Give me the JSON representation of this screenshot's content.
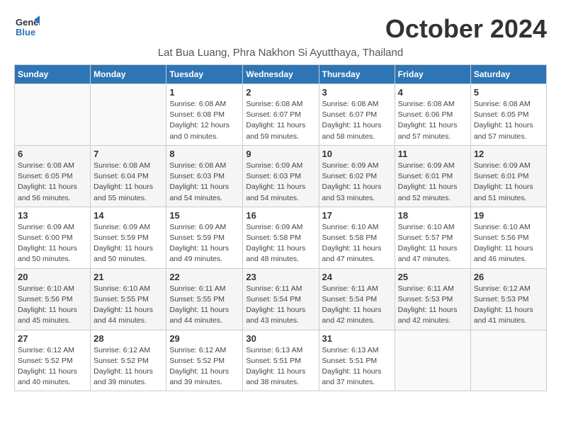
{
  "logo": {
    "line1": "General",
    "line2": "Blue"
  },
  "title": "October 2024",
  "subtitle": "Lat Bua Luang, Phra Nakhon Si Ayutthaya, Thailand",
  "header": {
    "days": [
      "Sunday",
      "Monday",
      "Tuesday",
      "Wednesday",
      "Thursday",
      "Friday",
      "Saturday"
    ]
  },
  "weeks": [
    [
      {
        "day": "",
        "info": ""
      },
      {
        "day": "",
        "info": ""
      },
      {
        "day": "1",
        "info": "Sunrise: 6:08 AM\nSunset: 6:08 PM\nDaylight: 12 hours\nand 0 minutes."
      },
      {
        "day": "2",
        "info": "Sunrise: 6:08 AM\nSunset: 6:07 PM\nDaylight: 11 hours\nand 59 minutes."
      },
      {
        "day": "3",
        "info": "Sunrise: 6:08 AM\nSunset: 6:07 PM\nDaylight: 11 hours\nand 58 minutes."
      },
      {
        "day": "4",
        "info": "Sunrise: 6:08 AM\nSunset: 6:06 PM\nDaylight: 11 hours\nand 57 minutes."
      },
      {
        "day": "5",
        "info": "Sunrise: 6:08 AM\nSunset: 6:05 PM\nDaylight: 11 hours\nand 57 minutes."
      }
    ],
    [
      {
        "day": "6",
        "info": "Sunrise: 6:08 AM\nSunset: 6:05 PM\nDaylight: 11 hours\nand 56 minutes."
      },
      {
        "day": "7",
        "info": "Sunrise: 6:08 AM\nSunset: 6:04 PM\nDaylight: 11 hours\nand 55 minutes."
      },
      {
        "day": "8",
        "info": "Sunrise: 6:08 AM\nSunset: 6:03 PM\nDaylight: 11 hours\nand 54 minutes."
      },
      {
        "day": "9",
        "info": "Sunrise: 6:09 AM\nSunset: 6:03 PM\nDaylight: 11 hours\nand 54 minutes."
      },
      {
        "day": "10",
        "info": "Sunrise: 6:09 AM\nSunset: 6:02 PM\nDaylight: 11 hours\nand 53 minutes."
      },
      {
        "day": "11",
        "info": "Sunrise: 6:09 AM\nSunset: 6:01 PM\nDaylight: 11 hours\nand 52 minutes."
      },
      {
        "day": "12",
        "info": "Sunrise: 6:09 AM\nSunset: 6:01 PM\nDaylight: 11 hours\nand 51 minutes."
      }
    ],
    [
      {
        "day": "13",
        "info": "Sunrise: 6:09 AM\nSunset: 6:00 PM\nDaylight: 11 hours\nand 50 minutes."
      },
      {
        "day": "14",
        "info": "Sunrise: 6:09 AM\nSunset: 5:59 PM\nDaylight: 11 hours\nand 50 minutes."
      },
      {
        "day": "15",
        "info": "Sunrise: 6:09 AM\nSunset: 5:59 PM\nDaylight: 11 hours\nand 49 minutes."
      },
      {
        "day": "16",
        "info": "Sunrise: 6:09 AM\nSunset: 5:58 PM\nDaylight: 11 hours\nand 48 minutes."
      },
      {
        "day": "17",
        "info": "Sunrise: 6:10 AM\nSunset: 5:58 PM\nDaylight: 11 hours\nand 47 minutes."
      },
      {
        "day": "18",
        "info": "Sunrise: 6:10 AM\nSunset: 5:57 PM\nDaylight: 11 hours\nand 47 minutes."
      },
      {
        "day": "19",
        "info": "Sunrise: 6:10 AM\nSunset: 5:56 PM\nDaylight: 11 hours\nand 46 minutes."
      }
    ],
    [
      {
        "day": "20",
        "info": "Sunrise: 6:10 AM\nSunset: 5:56 PM\nDaylight: 11 hours\nand 45 minutes."
      },
      {
        "day": "21",
        "info": "Sunrise: 6:10 AM\nSunset: 5:55 PM\nDaylight: 11 hours\nand 44 minutes."
      },
      {
        "day": "22",
        "info": "Sunrise: 6:11 AM\nSunset: 5:55 PM\nDaylight: 11 hours\nand 44 minutes."
      },
      {
        "day": "23",
        "info": "Sunrise: 6:11 AM\nSunset: 5:54 PM\nDaylight: 11 hours\nand 43 minutes."
      },
      {
        "day": "24",
        "info": "Sunrise: 6:11 AM\nSunset: 5:54 PM\nDaylight: 11 hours\nand 42 minutes."
      },
      {
        "day": "25",
        "info": "Sunrise: 6:11 AM\nSunset: 5:53 PM\nDaylight: 11 hours\nand 42 minutes."
      },
      {
        "day": "26",
        "info": "Sunrise: 6:12 AM\nSunset: 5:53 PM\nDaylight: 11 hours\nand 41 minutes."
      }
    ],
    [
      {
        "day": "27",
        "info": "Sunrise: 6:12 AM\nSunset: 5:52 PM\nDaylight: 11 hours\nand 40 minutes."
      },
      {
        "day": "28",
        "info": "Sunrise: 6:12 AM\nSunset: 5:52 PM\nDaylight: 11 hours\nand 39 minutes."
      },
      {
        "day": "29",
        "info": "Sunrise: 6:12 AM\nSunset: 5:52 PM\nDaylight: 11 hours\nand 39 minutes."
      },
      {
        "day": "30",
        "info": "Sunrise: 6:13 AM\nSunset: 5:51 PM\nDaylight: 11 hours\nand 38 minutes."
      },
      {
        "day": "31",
        "info": "Sunrise: 6:13 AM\nSunset: 5:51 PM\nDaylight: 11 hours\nand 37 minutes."
      },
      {
        "day": "",
        "info": ""
      },
      {
        "day": "",
        "info": ""
      }
    ]
  ]
}
